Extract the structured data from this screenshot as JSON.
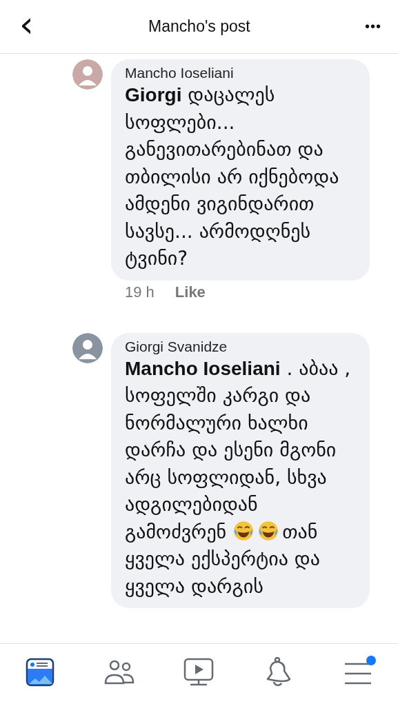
{
  "header": {
    "back": "‹",
    "title": "Mancho's post",
    "more": "•••"
  },
  "comments": [
    {
      "author": "Mancho Ioseliani",
      "rows": [
        [
          {
            "kind": "text",
            "text": "**Giorgi** დაცალეს სოფლები... განევითარებინათ და თბილისი არ იქნებოდა ამდენი ვიგინდარით სავსე... არმოდღნეს ტვინი?"
          }
        ]
      ],
      "time": "19 h",
      "like": "Like"
    },
    {
      "author": "Giorgi Svanidze",
      "rows": [
        [
          {
            "kind": "text",
            "text": "**Mancho Ioseliani** . აბაა , სოფელში კარგი და ნორმალური ხალხი დარჩა და ესენი მგონი არც სოფლიდან, სხვა ადგილებიდან"
          }
        ],
        [
          {
            "kind": "text",
            "text": "გამოძვრენ"
          },
          {
            "kind": "laugh"
          },
          {
            "kind": "laugh"
          },
          {
            "kind": "text",
            "text": "თან"
          }
        ],
        [
          {
            "kind": "text",
            "text": "ყველა ექსპერტია და ყველა დარგის"
          }
        ]
      ]
    }
  ],
  "tabs": [
    {
      "kind": "feed",
      "selected": true,
      "badge": false
    },
    {
      "kind": "friends",
      "selected": false,
      "badge": false
    },
    {
      "kind": "video",
      "selected": false,
      "badge": false
    },
    {
      "kind": "bell",
      "selected": false,
      "badge": false
    },
    {
      "kind": "menu",
      "selected": false,
      "badge": true
    }
  ]
}
